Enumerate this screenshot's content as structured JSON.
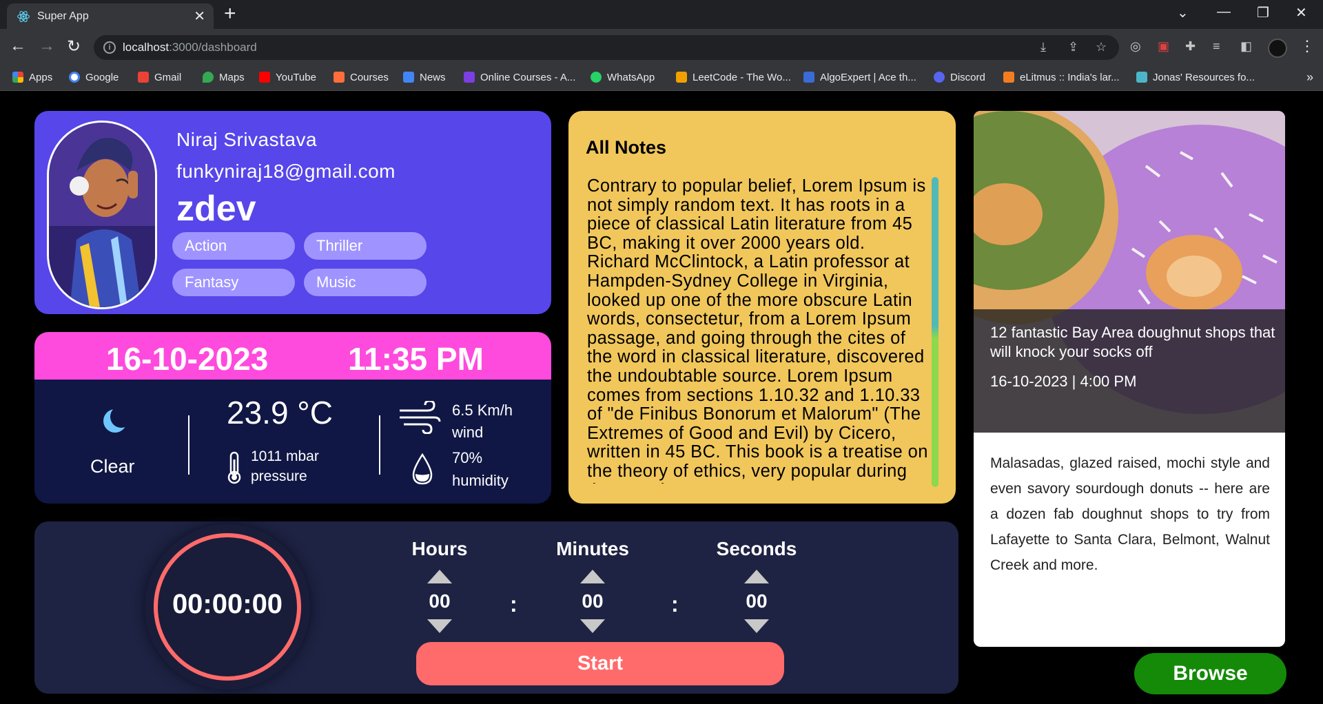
{
  "browser": {
    "tab_title": "Super App",
    "tab_close": "✕",
    "new_tab": "+",
    "url_host": "localhost",
    "url_path": ":3000/dashboard",
    "bookmarks": [
      {
        "label": "Apps",
        "color": "#ea4335"
      },
      {
        "label": "Google",
        "color": "#4285f4"
      },
      {
        "label": "Gmail",
        "color": "#ea4335"
      },
      {
        "label": "Maps",
        "color": "#34a853"
      },
      {
        "label": "YouTube",
        "color": "#ff0000"
      },
      {
        "label": "Courses",
        "color": "#ff6d3a"
      },
      {
        "label": "News",
        "color": "#4285f4"
      },
      {
        "label": "Online Courses - A...",
        "color": "#7b3fe4"
      },
      {
        "label": "WhatsApp",
        "color": "#25d366"
      },
      {
        "label": "LeetCode - The Wo...",
        "color": "#f0a000"
      },
      {
        "label": "AlgoExpert | Ace th...",
        "color": "#3b6bd6"
      },
      {
        "label": "Discord",
        "color": "#5865f2"
      },
      {
        "label": "eLitmus :: India's lar...",
        "color": "#f47c20"
      },
      {
        "label": "Jonas' Resources fo...",
        "color": "#4cb5c9"
      }
    ]
  },
  "profile": {
    "name": "Niraj Srivastava",
    "email": "funkyniraj18@gmail.com",
    "username": "zdev",
    "categories": [
      "Action",
      "Thriller",
      "Fantasy",
      "Music"
    ]
  },
  "weather": {
    "date": "16-10-2023",
    "time": "11:35 PM",
    "condition": "Clear",
    "temperature": "23.9 °C",
    "pressure_value": "1011 mbar",
    "pressure_label": "pressure",
    "wind_value": "6.5 Km/h",
    "wind_label": "wind",
    "humidity_value": "70%",
    "humidity_label": "humidity",
    "colors": {
      "header": "#ff4ade",
      "body": "#101744"
    }
  },
  "notes": {
    "title": "All Notes",
    "text": "Contrary to popular belief, Lorem Ipsum is not simply random text. It has roots in a piece of classical Latin literature from 45 BC, making it over 2000 years old. Richard McClintock, a Latin professor at Hampden-Sydney College in Virginia, looked up one of the more obscure Latin words, consectetur, from a Lorem Ipsum passage, and going through the cites of the word in classical literature, discovered the undoubtable source. Lorem Ipsum comes from sections 1.10.32 and 1.10.33 of \"de Finibus Bonorum et Malorum\" (The Extremes of Good and Evil) by Cicero, written in 45 BC. This book is a treatise on the theory of ethics, very popular during the Renaissance."
  },
  "news": {
    "title": "12 fantastic Bay Area doughnut shops that will knock your socks off",
    "date": "16-10-2023 | 4:00 PM",
    "description": "Malasadas, glazed raised, mochi style and even savory sourdough donuts -- here are a dozen fab doughnut shops to try from Lafayette to Santa Clara, Belmont, Walnut Creek and more."
  },
  "timer": {
    "display": "00:00:00",
    "hours_label": "Hours",
    "minutes_label": "Minutes",
    "seconds_label": "Seconds",
    "hours": "00",
    "minutes": "00",
    "seconds": "00",
    "separator": ":",
    "start_label": "Start",
    "ring_color": "#ff6a6a"
  },
  "browse_label": "Browse"
}
